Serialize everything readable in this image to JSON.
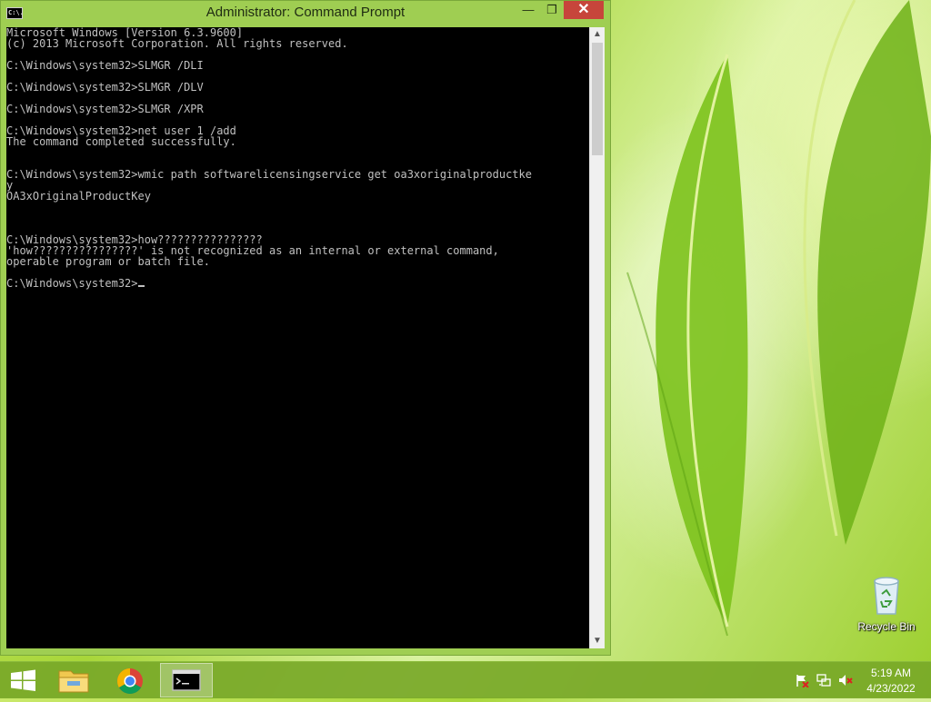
{
  "window": {
    "title": "Administrator: Command Prompt",
    "title_icon_text": "C:\\.",
    "min_glyph": "—",
    "max_glyph": "❐",
    "close_glyph": "✕"
  },
  "console": {
    "lines": [
      "Microsoft Windows [Version 6.3.9600]",
      "(c) 2013 Microsoft Corporation. All rights reserved.",
      "",
      "C:\\Windows\\system32>SLMGR /DLI",
      "",
      "C:\\Windows\\system32>SLMGR /DLV",
      "",
      "C:\\Windows\\system32>SLMGR /XPR",
      "",
      "C:\\Windows\\system32>net user 1 /add",
      "The command completed successfully.",
      "",
      "",
      "C:\\Windows\\system32>wmic path softwarelicensingservice get oa3xoriginalproductke",
      "y",
      "OA3xOriginalProductKey",
      "",
      "",
      "",
      "C:\\Windows\\system32>how????????????????",
      "'how????????????????' is not recognized as an internal or external command,",
      "operable program or batch file.",
      "",
      "C:\\Windows\\system32>"
    ]
  },
  "desktop": {
    "recycle_bin_label": "Recycle Bin"
  },
  "taskbar": {
    "apps": [
      "start-icon",
      "file-explorer-icon",
      "chrome-icon",
      "command-prompt-icon"
    ],
    "tray_icons": [
      "action-center-flag-icon",
      "network-icon",
      "volume-muted-icon"
    ],
    "time": "5:19 AM",
    "date": "4/23/2022"
  },
  "colors": {
    "console_bg": "#000000",
    "console_fg": "#c0c0c0",
    "close_button": "#c7453b",
    "window_frame": "#9fce52"
  }
}
